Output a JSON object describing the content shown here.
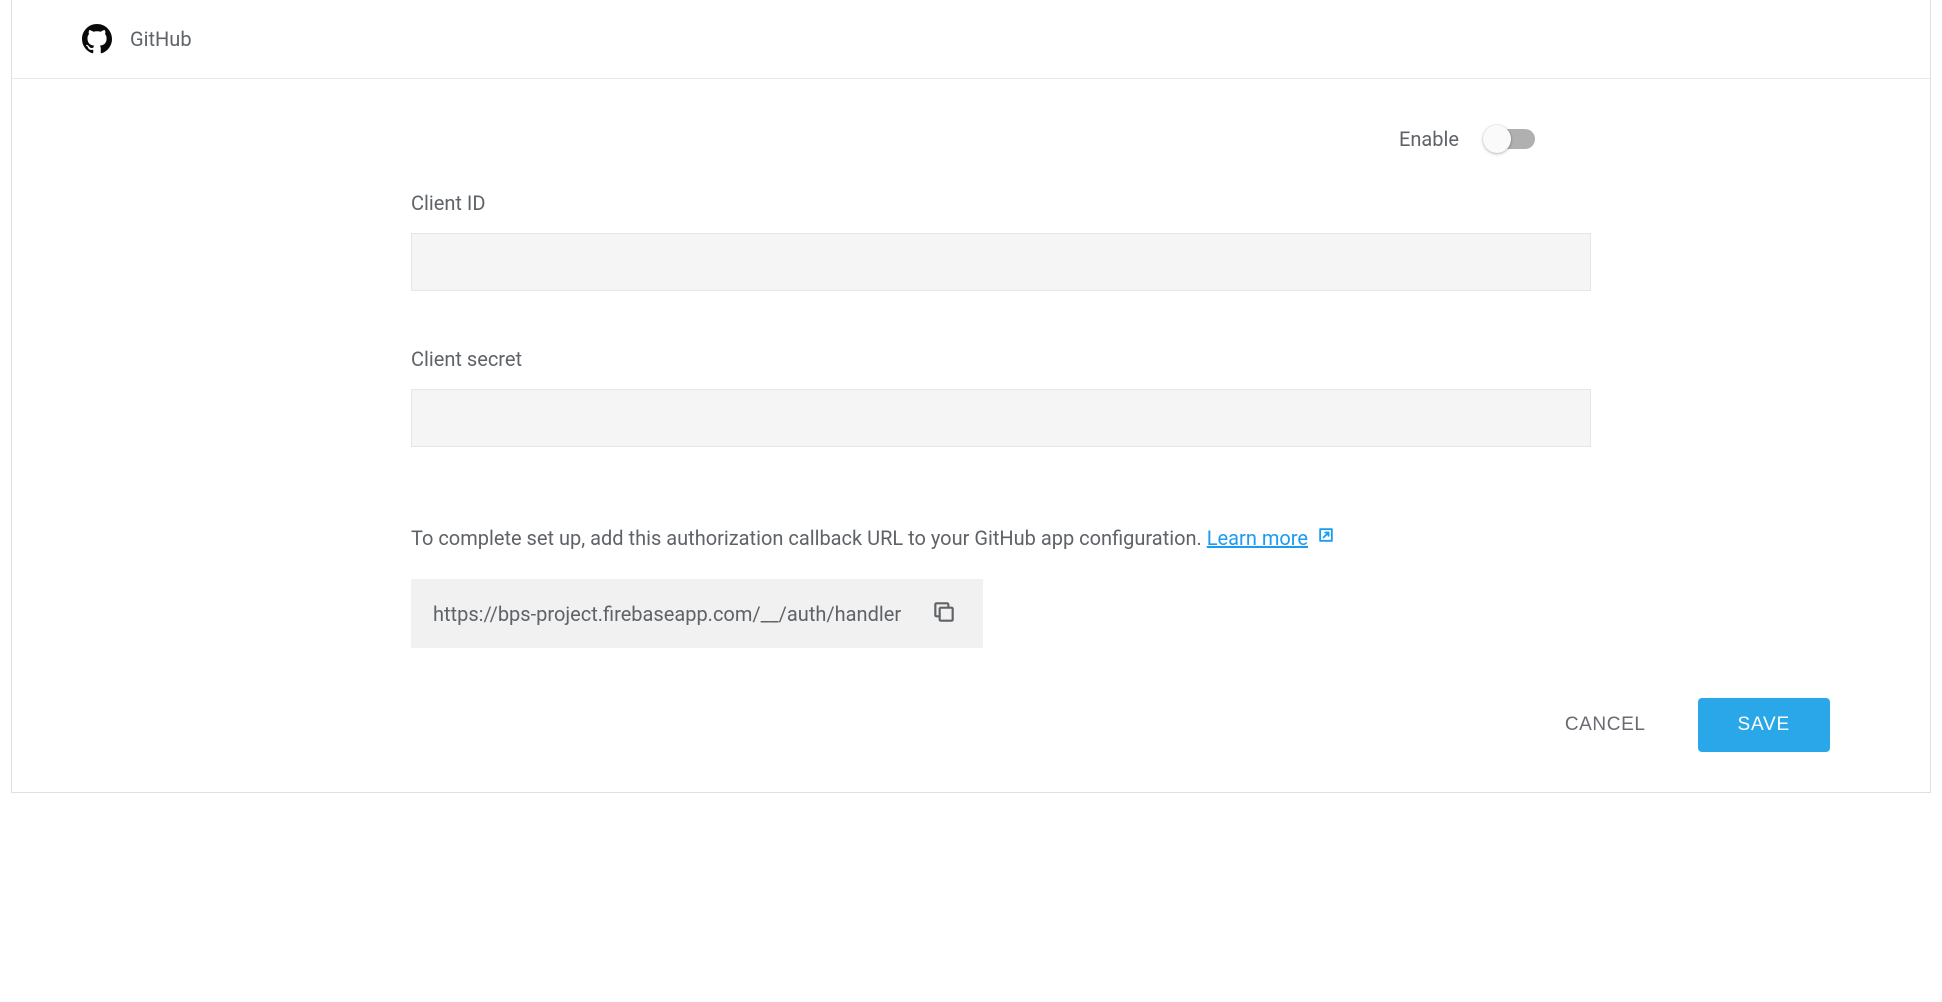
{
  "provider": {
    "name": "GitHub",
    "icon": "github-icon"
  },
  "enable": {
    "label": "Enable",
    "value": false
  },
  "fields": {
    "client_id": {
      "label": "Client ID",
      "value": ""
    },
    "client_secret": {
      "label": "Client secret",
      "value": ""
    }
  },
  "callback": {
    "help_text": "To complete set up, add this authorization callback URL to your GitHub app configuration. ",
    "learn_more_label": "Learn more",
    "url": "https://bps-project.firebaseapp.com/__/auth/handler"
  },
  "actions": {
    "cancel_label": "CANCEL",
    "save_label": "SAVE"
  }
}
